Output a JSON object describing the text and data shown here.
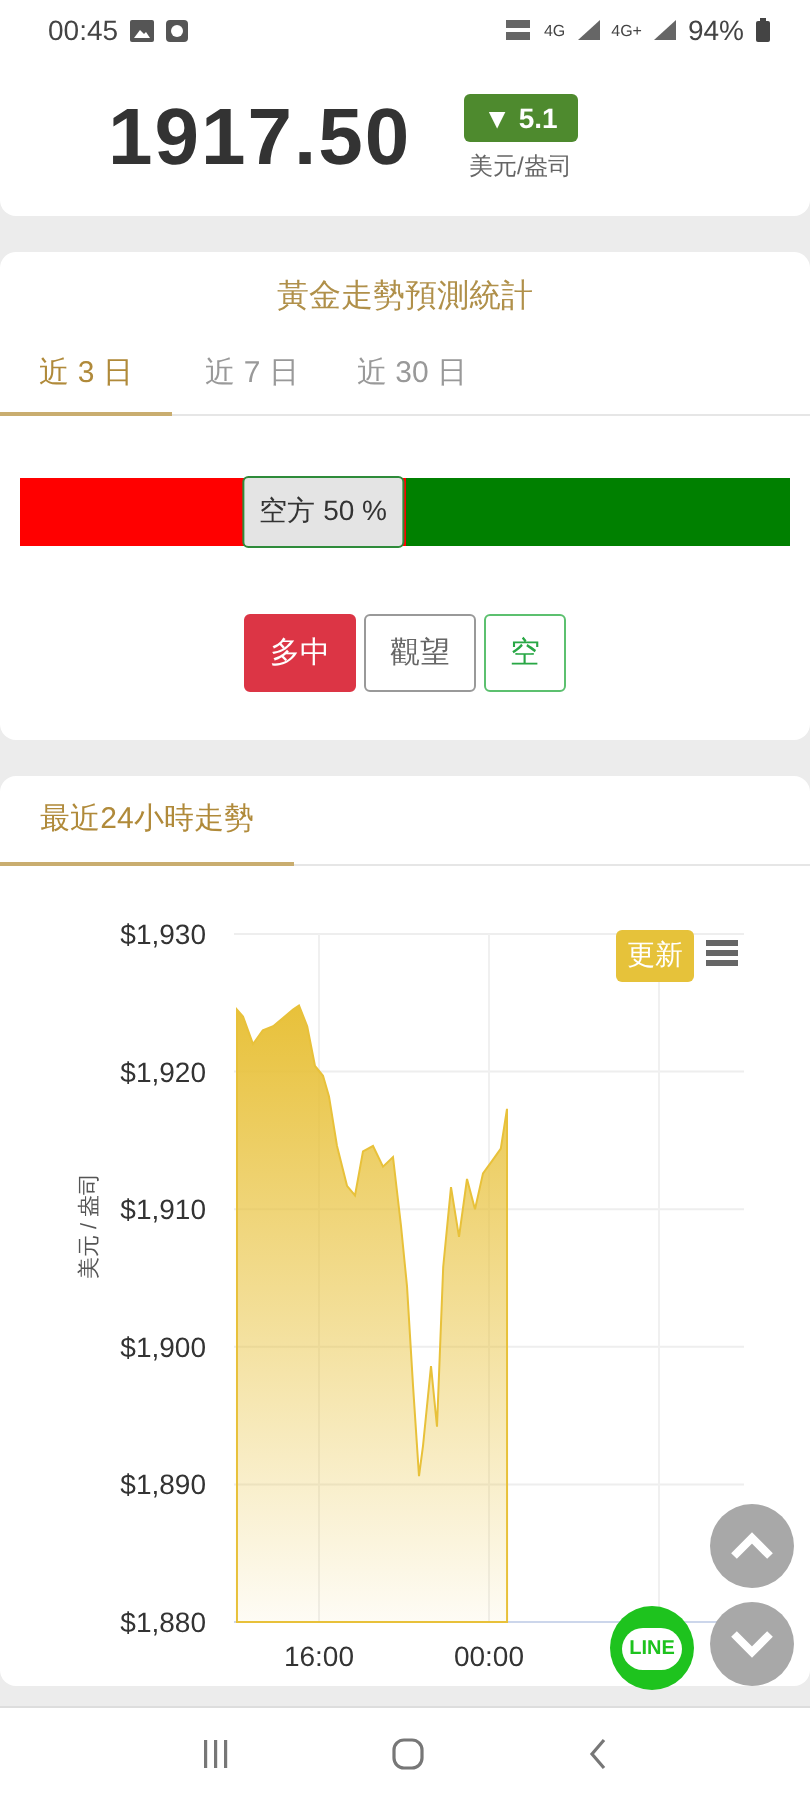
{
  "status_bar": {
    "time": "00:45",
    "network_labels": [
      "4G",
      "4G+"
    ],
    "battery": "94%"
  },
  "price": {
    "value": "1917.50",
    "change": "▼ 5.1",
    "unit": "美元/盎司"
  },
  "forecast": {
    "title": "黃金走勢預測統計",
    "tabs": [
      {
        "label": "近 3 日",
        "selected": true
      },
      {
        "label": "近 7 日",
        "selected": false
      },
      {
        "label": "近 30 日",
        "selected": false
      }
    ],
    "ratio": {
      "tooltip": "空方 50 %"
    },
    "buttons": [
      {
        "label": "多中",
        "kind": "long",
        "selected": true
      },
      {
        "label": "觀望",
        "kind": "neutral",
        "selected": false
      },
      {
        "label": "空",
        "kind": "short",
        "selected": false
      }
    ]
  },
  "trend": {
    "tab": {
      "label": "最近24小時走勢",
      "selected": true
    },
    "refresh_button": "更新",
    "chart_data": {
      "type": "area",
      "grid": true,
      "ylabel": "美元 / 盎司",
      "xlim": [
        12,
        36
      ],
      "ylim": [
        1880,
        1930
      ],
      "xticks": [
        {
          "value": 16,
          "label": "16:00"
        },
        {
          "value": 24,
          "label": "00:00"
        }
      ],
      "yticks": [
        {
          "value": 1880,
          "label": "$1,880"
        },
        {
          "value": 1890,
          "label": "$1,890"
        },
        {
          "value": 1900,
          "label": "$1,900"
        },
        {
          "value": 1910,
          "label": "$1,910"
        },
        {
          "value": 1920,
          "label": "$1,920"
        },
        {
          "value": 1930,
          "label": "$1,930"
        }
      ],
      "x": [
        12.14,
        12.42,
        12.89,
        13.36,
        13.84,
        14.31,
        14.78,
        15.06,
        15.44,
        15.81,
        16.19,
        16.47,
        16.85,
        17.32,
        17.69,
        18.07,
        18.54,
        19.01,
        19.48,
        19.86,
        20.14,
        20.42,
        20.71,
        20.89,
        21.27,
        21.55,
        21.84,
        22.21,
        22.59,
        22.96,
        23.34,
        23.72,
        24.19,
        24.56,
        24.85
      ],
      "series": [
        {
          "color": "#e8c13a",
          "values": [
            1924.5,
            1924,
            1922,
            1923,
            1923.3,
            1923.9,
            1924.5,
            1924.8,
            1923.3,
            1920.4,
            1919.7,
            1918.2,
            1914.6,
            1911.7,
            1911,
            1914.2,
            1914.6,
            1913.1,
            1913.8,
            1908.8,
            1904.4,
            1897.2,
            1890.6,
            1892.8,
            1898.6,
            1894.2,
            1905.8,
            1911.6,
            1908,
            1912.2,
            1910,
            1912.6,
            1913.6,
            1914.4,
            1917.3
          ]
        }
      ]
    }
  },
  "line_button": "LINE"
}
